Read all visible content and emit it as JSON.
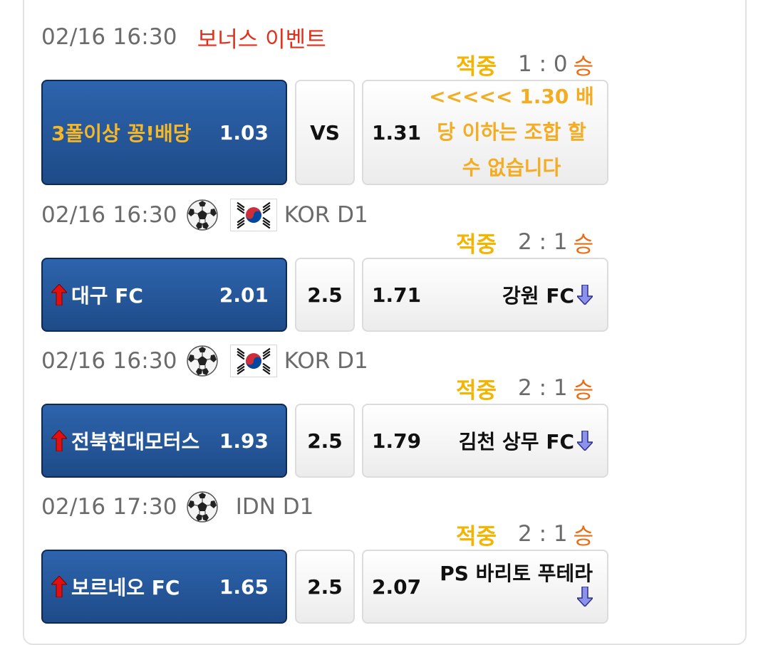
{
  "matches": [
    {
      "time": "02/16 16:30",
      "title": "보너스 이벤트",
      "league": "",
      "result": {
        "hit": "적중",
        "score": "1 : 0",
        "outcome": "승"
      },
      "home": {
        "name": "3폴이상 꽁!배당",
        "odds": "1.03"
      },
      "middle": "VS",
      "away": {
        "odds": "1.31",
        "name": "<<<<< 1.30 배당 이하는 조합 할수 없습니다"
      }
    },
    {
      "time": "02/16 16:30",
      "league": "KOR D1",
      "result": {
        "hit": "적중",
        "score": "2 : 1",
        "outcome": "승"
      },
      "home": {
        "name": "대구 FC",
        "odds": "2.01"
      },
      "middle": "2.5",
      "away": {
        "odds": "1.71",
        "name": "강원 FC"
      }
    },
    {
      "time": "02/16 16:30",
      "league": "KOR D1",
      "result": {
        "hit": "적중",
        "score": "2 : 1",
        "outcome": "승"
      },
      "home": {
        "name": "전북현대모터스",
        "odds": "1.93"
      },
      "middle": "2.5",
      "away": {
        "odds": "1.79",
        "name": "김천 상무 FC"
      }
    },
    {
      "time": "02/16 17:30",
      "league": "IDN D1",
      "result": {
        "hit": "적중",
        "score": "2 : 1",
        "outcome": "승"
      },
      "home": {
        "name": "보르네오 FC",
        "odds": "1.65"
      },
      "middle": "2.5",
      "away": {
        "odds": "2.07",
        "name": "PS 바리토 푸테라"
      }
    }
  ],
  "colors": {
    "home_button": "#1e4b88",
    "gold_text": "#f4b400",
    "event_title": "#e0301e",
    "outcome": "#ee6a10",
    "up_arrow": "#e01010",
    "down_arrow": "#7f86e6"
  }
}
